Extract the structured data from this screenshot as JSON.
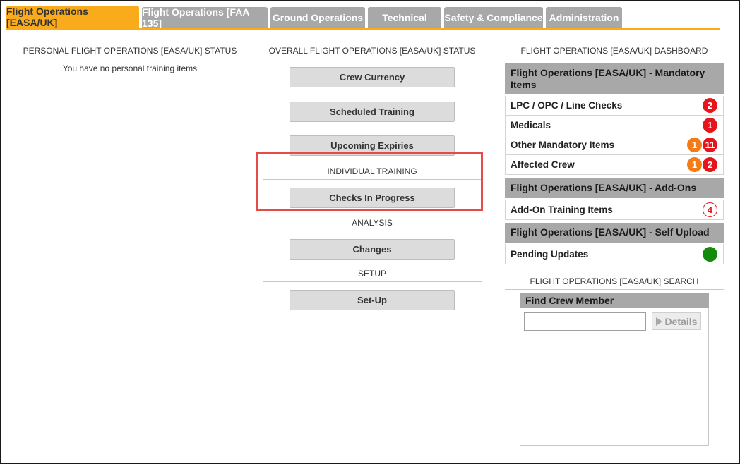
{
  "tabs": [
    {
      "label": "Flight Operations [EASA/UK]",
      "active": true
    },
    {
      "label": "Flight Operations [FAA 135]",
      "active": false
    },
    {
      "label": "Ground Operations",
      "active": false
    },
    {
      "label": "Technical",
      "active": false
    },
    {
      "label": "Safety & Compliance",
      "active": false
    },
    {
      "label": "Administration",
      "active": false
    }
  ],
  "personal": {
    "heading": "PERSONAL FLIGHT OPERATIONS [EASA/UK] STATUS",
    "empty_message": "You have no personal training items"
  },
  "overall": {
    "heading": "OVERALL FLIGHT OPERATIONS [EASA/UK] STATUS",
    "buttons": {
      "crew_currency": "Crew Currency",
      "scheduled_training": "Scheduled Training",
      "upcoming_expiries": "Upcoming Expiries",
      "checks_in_progress": "Checks In Progress",
      "changes": "Changes",
      "setup": "Set-Up"
    },
    "sections": {
      "individual_training": "INDIVIDUAL TRAINING",
      "analysis": "ANALYSIS",
      "setup": "SETUP"
    }
  },
  "dashboard": {
    "heading": "FLIGHT OPERATIONS [EASA/UK] DASHBOARD",
    "mandatory_header": "Flight Operations [EASA/UK] - Mandatory Items",
    "mandatory_rows": [
      {
        "label": "LPC / OPC / Line Checks",
        "badges": [
          {
            "value": "2",
            "style": "red"
          }
        ]
      },
      {
        "label": "Medicals",
        "badges": [
          {
            "value": "1",
            "style": "red"
          }
        ]
      },
      {
        "label": "Other Mandatory Items",
        "badges": [
          {
            "value": "1",
            "style": "orange"
          },
          {
            "value": "11",
            "style": "red"
          }
        ]
      },
      {
        "label": "Affected Crew",
        "badges": [
          {
            "value": "1",
            "style": "orange"
          },
          {
            "value": "2",
            "style": "red"
          }
        ]
      }
    ],
    "addons_header": "Flight Operations [EASA/UK] - Add-Ons",
    "addons_row": {
      "label": "Add-On Training Items",
      "badge": "4"
    },
    "selfupload_header": "Flight Operations [EASA/UK] - Self Upload",
    "selfupload_row": {
      "label": "Pending Updates",
      "status_color": "#138a0c"
    }
  },
  "search": {
    "heading": "FLIGHT OPERATIONS [EASA/UK] SEARCH",
    "panel_title": "Find Crew Member",
    "input_value": "",
    "details_label": "Details"
  },
  "colors": {
    "accent": "#f9ab1c",
    "badge_red": "#e8141b",
    "badge_orange": "#f47b16",
    "highlight": "#e84a4a"
  }
}
